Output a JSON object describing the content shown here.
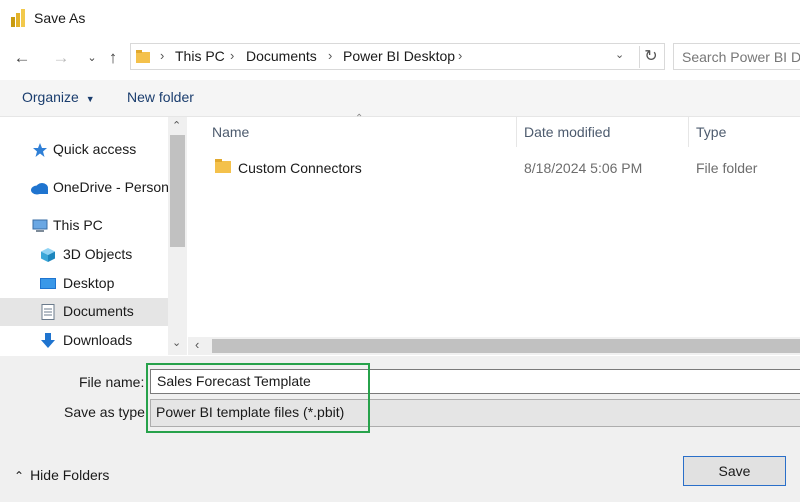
{
  "window": {
    "title": "Save As"
  },
  "nav": {
    "breadcrumb": [
      "This PC",
      "Documents",
      "Power BI Desktop"
    ],
    "search_placeholder": "Search Power BI Desktop"
  },
  "toolbar": {
    "organize": "Organize",
    "new_folder": "New folder"
  },
  "sidebar": {
    "items": [
      {
        "label": "Quick access",
        "icon": "star-icon"
      },
      {
        "label": "OneDrive - Personal",
        "icon": "cloud-icon"
      },
      {
        "label": "This PC",
        "icon": "computer-icon"
      },
      {
        "label": "3D Objects",
        "icon": "cube-icon"
      },
      {
        "label": "Desktop",
        "icon": "desktop-icon"
      },
      {
        "label": "Documents",
        "icon": "document-icon",
        "selected": true
      },
      {
        "label": "Downloads",
        "icon": "download-icon"
      }
    ]
  },
  "file_list": {
    "columns": [
      "Name",
      "Date modified",
      "Type"
    ],
    "rows": [
      {
        "name": "Custom Connectors",
        "date": "8/18/2024 5:06 PM",
        "type": "File folder"
      }
    ]
  },
  "form": {
    "file_name_label": "File name:",
    "file_name_value": "Sales Forecast Template",
    "save_type_label": "Save as type:",
    "save_type_value": "Power BI template files (*.pbit)"
  },
  "footer": {
    "hide_folders": "Hide Folders",
    "save": "Save"
  },
  "colors": {
    "highlight": "#27a24b",
    "accent": "#2a6fc9",
    "folder": "#f4c14b"
  }
}
